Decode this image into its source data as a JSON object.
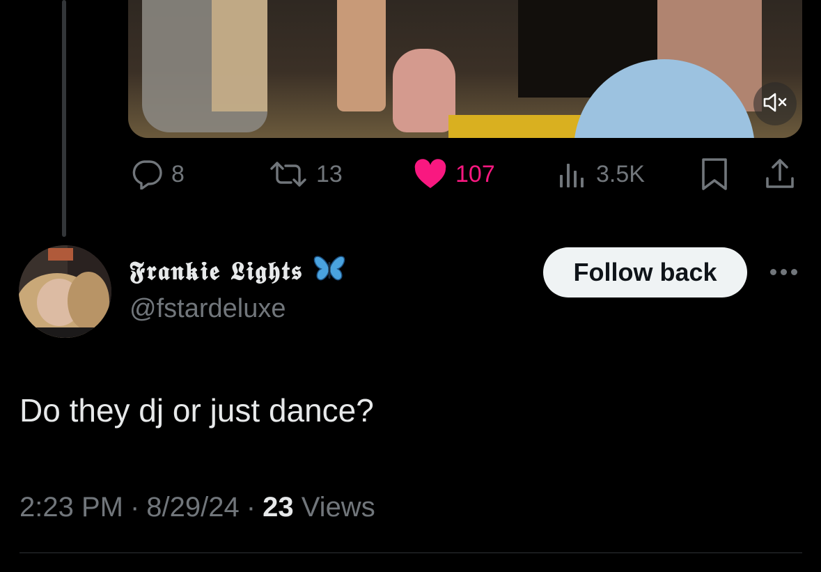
{
  "parent_tweet": {
    "media": {
      "mute_icon": "speaker-muted-icon"
    },
    "actions": {
      "replies": "8",
      "reposts": "13",
      "likes": "107",
      "views": "3.5K",
      "reply_icon": "reply-icon",
      "repost_icon": "repost-icon",
      "like_icon": "heart-icon",
      "views_icon": "analytics-icon",
      "bookmark_icon": "bookmark-icon",
      "share_icon": "share-icon",
      "like_color": "#f91880"
    }
  },
  "reply": {
    "author": {
      "display_name": "𝕱𝖗𝖆𝖓𝖐𝖎𝖊 𝕷𝖎𝖌𝖍𝖙𝖘",
      "emoji": "🦋",
      "handle": "@fstardeluxe"
    },
    "follow_label": "Follow back",
    "more_icon": "more-icon",
    "text": "Do they dj or just dance?",
    "time": "2:23 PM",
    "date": "8/29/24",
    "separator": "·",
    "views_count": "23",
    "views_label": "Views"
  },
  "colors": {
    "background": "#000000",
    "primary_text": "#e7e9ea",
    "secondary_text": "#71767b",
    "like_pink": "#f91880",
    "emoji_blue": "#4aa3df"
  }
}
